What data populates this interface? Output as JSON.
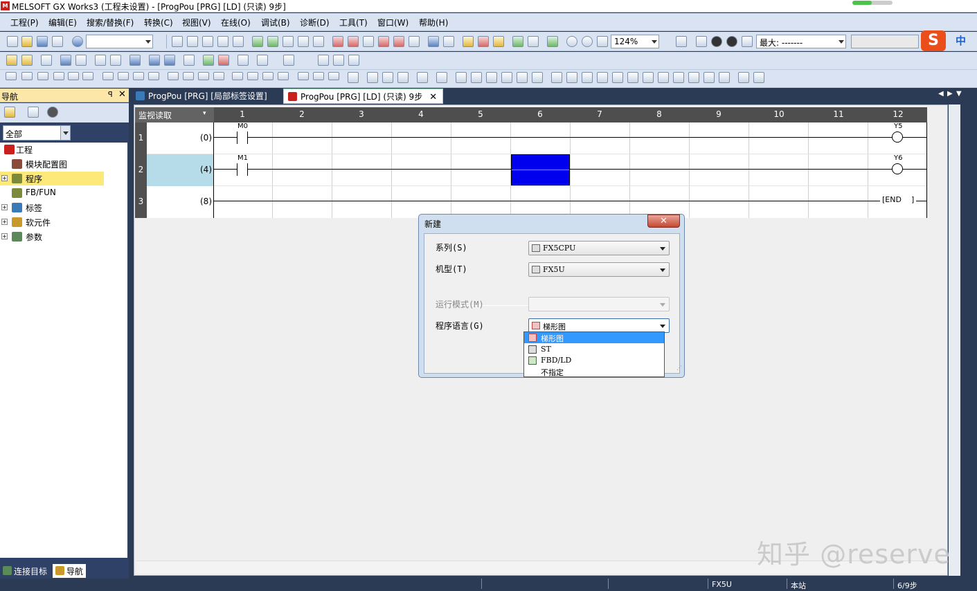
{
  "window": {
    "title": "MELSOFT GX Works3 (工程未设置) - [ProgPou [PRG] [LD] (只读) 9步]"
  },
  "menu": [
    "工程(P)",
    "编辑(E)",
    "搜索/替换(F)",
    "转换(C)",
    "视图(V)",
    "在线(O)",
    "调试(B)",
    "诊断(D)",
    "工具(T)",
    "窗口(W)",
    "帮助(H)"
  ],
  "toolbar": {
    "zoom": "124%",
    "max_label": "最大: -------",
    "sogou": "S",
    "ime": "中"
  },
  "fkeys": [
    "F5",
    "sF5",
    "F6",
    "sF6",
    "F7",
    "F8",
    "F9",
    "cF9",
    "cF10",
    "sF7",
    "sF8",
    "aF7",
    "aF8",
    "saF5",
    "saF6",
    "saF7",
    "saF8",
    "aF5",
    "caF5",
    "caF10"
  ],
  "nav": {
    "title": "导航",
    "pin": "ᵖ",
    "close": "✕",
    "filter": "全部",
    "tree": [
      {
        "label": "工程",
        "expander": ""
      },
      {
        "label": "模块配置图",
        "expander": ""
      },
      {
        "label": "程序",
        "expander": "+"
      },
      {
        "label": "FB/FUN",
        "expander": ""
      },
      {
        "label": "标签",
        "expander": "+"
      },
      {
        "label": "软元件",
        "expander": "+"
      },
      {
        "label": "参数",
        "expander": "+"
      }
    ],
    "bottom_tabs": [
      "连接目标",
      "导航"
    ]
  },
  "tabs": [
    {
      "label": "ProgPou [PRG] [局部标签设置]"
    },
    {
      "label": "ProgPou [PRG] [LD] (只读) 9步",
      "close": "✕"
    }
  ],
  "ladder": {
    "monitor_mode": "监视读取",
    "columns": [
      "1",
      "2",
      "3",
      "4",
      "5",
      "6",
      "7",
      "8",
      "9",
      "10",
      "11",
      "12"
    ],
    "rows": [
      {
        "num": "1",
        "step": "(0)",
        "contact": "M0",
        "coil": "Y5"
      },
      {
        "num": "2",
        "step": "(4)",
        "contact": "M1",
        "coil": "Y6"
      },
      {
        "num": "3",
        "step": "(8)",
        "end": "END"
      }
    ]
  },
  "dialog": {
    "title": "新建",
    "close": "✕",
    "series_label": "系列(S)",
    "series_value": "FX5CPU",
    "model_label": "机型(T)",
    "model_value": "FX5U",
    "mode_label": "运行模式(M)",
    "mode_value": "",
    "lang_label": "程序语言(G)",
    "lang_value": "梯形图",
    "lang_options": [
      "梯形图",
      "ST",
      "FBD/LD",
      "不指定"
    ]
  },
  "status": {
    "cpu": "FX5U",
    "station": "本站",
    "steps": "6/9步"
  },
  "watermark": "知乎 @reserve"
}
